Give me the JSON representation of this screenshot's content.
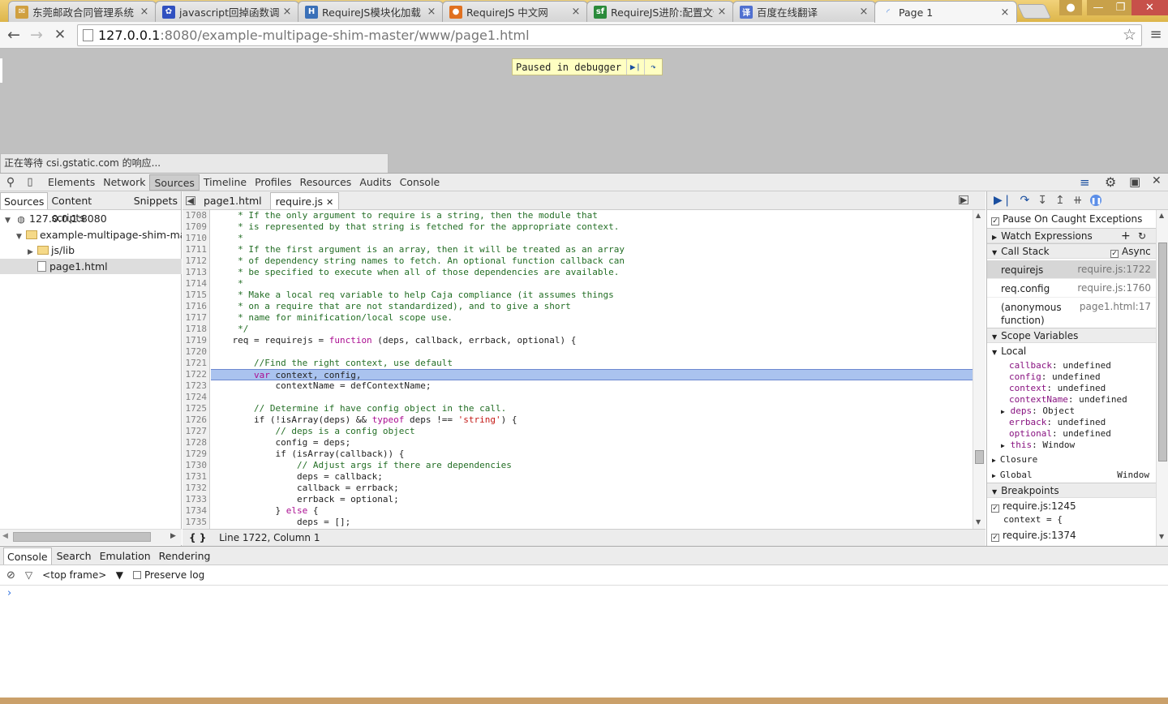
{
  "browser": {
    "tabs": [
      {
        "title": "东莞邮政合同管理系统",
        "favicon": "envelope-icon",
        "color": "#d0a040"
      },
      {
        "title": "javascript回掉函数调试",
        "favicon": "paw-icon",
        "color": "#3050c0"
      },
      {
        "title": "RequireJS模块化加载",
        "favicon": "h-icon",
        "color": "#3a70b8"
      },
      {
        "title": "RequireJS 中文网",
        "favicon": "globe-icon",
        "color": "#e07020"
      },
      {
        "title": "RequireJS进阶:配置文件",
        "favicon": "sf-icon",
        "color": "#2a8a3a"
      },
      {
        "title": "百度在线翻译",
        "favicon": "translate-icon",
        "color": "#5070d0"
      },
      {
        "title": "Page 1",
        "favicon": "loading-spinner-icon",
        "color": "#4080e0",
        "active": true
      }
    ],
    "close_glyph": "×",
    "url_host": "127.0.0.1",
    "url_rest": ":8080/example-multipage-shim-master/www/page1.html"
  },
  "page": {
    "paused_label": "Paused in debugger",
    "status_text": "正在等待 csi.gstatic.com 的响应..."
  },
  "devtools": {
    "tabs": [
      "Elements",
      "Network",
      "Sources",
      "Timeline",
      "Profiles",
      "Resources",
      "Audits",
      "Console"
    ],
    "active_tab": "Sources",
    "navigator_tabs": [
      "Sources",
      "Content scripts",
      "Snippets"
    ],
    "tree": [
      {
        "label": "127.0.0.1:8080",
        "depth": 0,
        "kind": "host",
        "open": true
      },
      {
        "label": "example-multipage-shim-master/",
        "depth": 1,
        "kind": "folder",
        "open": true
      },
      {
        "label": "js/lib",
        "depth": 2,
        "kind": "folder",
        "open": false
      },
      {
        "label": "page1.html",
        "depth": 2,
        "kind": "file",
        "selected": true
      }
    ],
    "file_tabs": [
      {
        "label": "page1.html",
        "active": false
      },
      {
        "label": "require.js",
        "active": true
      }
    ],
    "code_start_line": 1708,
    "highlight_line": 1722,
    "code": [
      "     * If the only argument to require is a string, then the module that",
      "     * is represented by that string is fetched for the appropriate context.",
      "     *",
      "     * If the first argument is an array, then it will be treated as an array",
      "     * of dependency string names to fetch. An optional function callback can",
      "     * be specified to execute when all of those dependencies are available.",
      "     *",
      "     * Make a local req variable to help Caja compliance (it assumes things",
      "     * on a require that are not standardized), and to give a short",
      "     * name for minification/local scope use.",
      "     */",
      "    req = requirejs = function (deps, callback, errback, optional) {",
      "",
      "        //Find the right context, use default",
      "        var context, config,",
      "            contextName = defContextName;",
      "",
      "        // Determine if have config object in the call.",
      "        if (!isArray(deps) && typeof deps !== 'string') {",
      "            // deps is a config object",
      "            config = deps;",
      "            if (isArray(callback)) {",
      "                // Adjust args if there are dependencies",
      "                deps = callback;",
      "                callback = errback;",
      "                errback = optional;",
      "            } else {",
      "                deps = [];"
    ],
    "cursor_status": "Line 1722, Column 1",
    "pretty_print_label": "{ }",
    "debugger": {
      "pause_on_caught": "Pause On Caught Exceptions",
      "watch_expressions": "Watch Expressions",
      "call_stack": "Call Stack",
      "async_label": "Async",
      "frames": [
        {
          "name": "requirejs",
          "location": "require.js:1722",
          "selected": true
        },
        {
          "name": "req.config",
          "location": "require.js:1760"
        },
        {
          "name": "(anonymous function)",
          "location": "page1.html:17"
        }
      ],
      "scope_variables": "Scope Variables",
      "local_label": "Local",
      "locals": [
        {
          "name": "callback",
          "value": "undefined"
        },
        {
          "name": "config",
          "value": "undefined"
        },
        {
          "name": "context",
          "value": "undefined"
        },
        {
          "name": "contextName",
          "value": "undefined"
        },
        {
          "name": "deps",
          "value": "Object",
          "expandable": true
        },
        {
          "name": "errback",
          "value": "undefined"
        },
        {
          "name": "optional",
          "value": "undefined"
        },
        {
          "name": "this",
          "value": "Window",
          "expandable": true
        }
      ],
      "closure_label": "Closure",
      "global_label": "Global",
      "global_value": "Window",
      "breakpoints_label": "Breakpoints",
      "breakpoints": [
        {
          "location": "require.js:1245",
          "snippet": "context = {"
        },
        {
          "location": "require.js:1374",
          "snippet": ""
        }
      ]
    },
    "drawer_tabs": [
      "Console",
      "Search",
      "Emulation",
      "Rendering"
    ],
    "frame_selector": "<top frame>",
    "preserve_log": "Preserve log",
    "prompt": "›"
  }
}
